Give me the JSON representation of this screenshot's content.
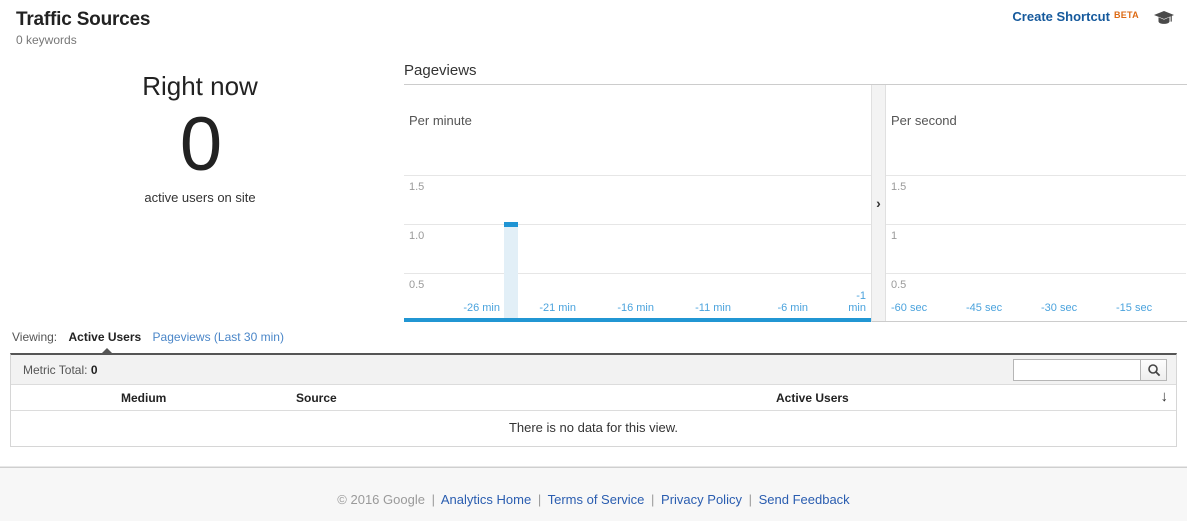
{
  "header": {
    "title": "Traffic Sources",
    "subtitle": "0 keywords",
    "create_shortcut": "Create Shortcut",
    "beta_badge": "BETA",
    "help_icon": "graduation-cap-icon"
  },
  "right_now": {
    "title": "Right now",
    "count": "0",
    "label": "active users on site"
  },
  "charts": {
    "heading": "Pageviews",
    "per_minute_label": "Per minute",
    "per_second_label": "Per second",
    "expand_icon": "chevron-right-icon"
  },
  "viewing": {
    "label": "Viewing:",
    "options": [
      {
        "label": "Active Users",
        "active": true
      },
      {
        "label": "Pageviews (Last 30 min)",
        "active": false
      }
    ]
  },
  "metric_bar": {
    "label": "Metric Total:",
    "value": "0",
    "search_value": "",
    "search_placeholder": "",
    "search_icon": "search-icon"
  },
  "table": {
    "columns": [
      "Medium",
      "Source",
      "Active Users"
    ],
    "sort_icon": "arrow-down-icon",
    "empty_message": "There is no data for this view.",
    "rows": []
  },
  "footer": {
    "copyright": "© 2016 Google",
    "links": [
      "Analytics Home",
      "Terms of Service",
      "Privacy Policy",
      "Send Feedback"
    ],
    "separator": "|"
  },
  "colors": {
    "link_blue": "#2a5db0",
    "shortcut_blue": "#15599c",
    "beta_orange": "#dd6a14",
    "chart_blue": "#2196d3",
    "bar_fill": "#e2eff7",
    "bar_cap": "#1f94d4",
    "axis_blue": "#4ba3dd"
  },
  "chart_data": [
    {
      "type": "bar",
      "title": "Pageviews",
      "subtitle": "Per minute",
      "xlabel": "",
      "ylabel": "",
      "ylim": [
        0,
        2
      ],
      "yticks": [
        1.5,
        1.0,
        0.5
      ],
      "ytick_labels": [
        "1.5",
        "1.0",
        "0.5"
      ],
      "grid": true,
      "x": [
        -30,
        -29,
        -28,
        -27,
        -26,
        -25,
        -24,
        -23,
        -22,
        -21,
        -20,
        -19,
        -18,
        -17,
        -16,
        -15,
        -14,
        -13,
        -12,
        -11,
        -10,
        -9,
        -8,
        -7,
        -6,
        -5,
        -4,
        -3,
        -2,
        -1
      ],
      "xtick_labels": [
        "-26 min",
        "-21 min",
        "-16 min",
        "-11 min",
        "-6 min",
        "-1\nmin"
      ],
      "xtick_positions": [
        -26,
        -21,
        -16,
        -11,
        -6,
        -1
      ],
      "values": [
        0,
        0,
        0,
        0,
        0,
        1,
        0,
        0,
        0,
        0,
        0,
        0,
        0,
        0,
        0,
        0,
        0,
        0,
        0,
        0,
        0,
        0,
        0,
        0,
        0,
        0,
        0,
        0,
        0,
        0
      ],
      "highlighted_bar": {
        "x": -25,
        "value": 1
      },
      "legend": []
    },
    {
      "type": "bar",
      "title": "Pageviews",
      "subtitle": "Per second",
      "xlabel": "",
      "ylabel": "",
      "ylim": [
        0,
        2
      ],
      "yticks": [
        1.5,
        1.0,
        0.5
      ],
      "ytick_labels": [
        "1.5",
        "1",
        "0.5"
      ],
      "grid": true,
      "x": [
        -60,
        -45,
        -30,
        -15
      ],
      "xtick_labels": [
        "-60 sec",
        "-45 sec",
        "-30 sec",
        "-15 sec"
      ],
      "xtick_positions": [
        -60,
        -45,
        -30,
        -15
      ],
      "values": [
        0,
        0,
        0,
        0
      ],
      "legend": []
    }
  ]
}
